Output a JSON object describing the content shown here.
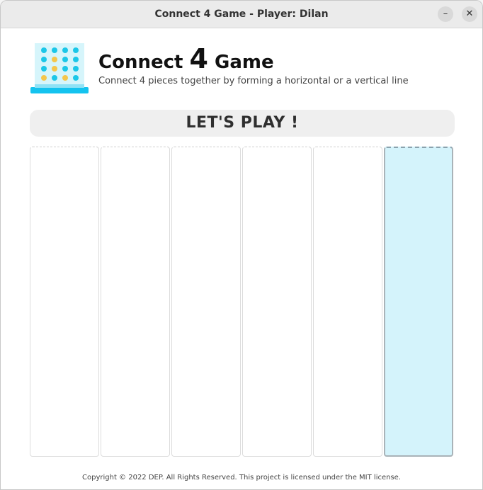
{
  "window": {
    "title": "Connect 4 Game - Player: Dilan",
    "minimize_glyph": "–",
    "close_glyph": "✕"
  },
  "header": {
    "title_prefix": "Connect",
    "title_number": "4",
    "title_suffix": "Game",
    "subtitle": "Connect 4 pieces together by forming a horizontal or a vertical line",
    "logo_icon": "connect-four-grid-icon"
  },
  "status": {
    "banner": "LET'S PLAY !"
  },
  "board": {
    "columns": 6,
    "active_column": 6,
    "colors": {
      "active_fill": "#d4f3fb",
      "piece_blue": "#1bc7e8",
      "piece_yellow": "#f5c64b"
    }
  },
  "footer": {
    "copyright": "Copyright © 2022 DEP. All Rights Reserved. This project is licensed under the MIT license."
  }
}
